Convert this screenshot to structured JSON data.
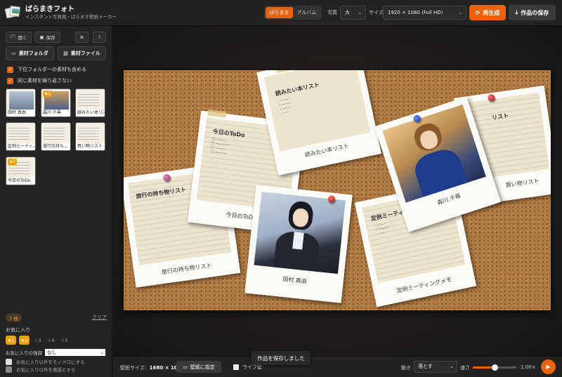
{
  "header": {
    "title": "ばらまきフォト",
    "subtitle": "インスタント写真風・ばらまき壁紙メーカー",
    "mode_tabs": [
      "ばらまき",
      "アルバム"
    ],
    "photo_label": "写真",
    "photo_size": "大",
    "size_label": "サイズ",
    "size_value": "1920 × 1080 (Full HD)",
    "regen_label": "再生成",
    "save_label": "作品の保存"
  },
  "sidebar": {
    "open_label": "開く",
    "save_label": "保存",
    "folder_btn": "素材フォルダ",
    "file_btn": "素材ファイル",
    "opt_subfolder": "下位フォルダーの素材も含める",
    "opt_norepeat": "同じ素材を繰り返さない",
    "thumbs": [
      {
        "caption": "田村 真由"
      },
      {
        "caption": "森川 千尋",
        "star": "★1"
      },
      {
        "caption": "読みたい本リスト"
      },
      {
        "caption": "定例ミーティ..."
      },
      {
        "caption": "旅行の持ち..."
      },
      {
        "caption": "買い物リスト"
      },
      {
        "caption": "今日のToDo",
        "star": "★2"
      }
    ],
    "count": "7 枚",
    "clear": "クリア",
    "fav_label": "お気に入り",
    "fav_buttons": [
      "★1",
      "★2",
      "☆3",
      "☆4",
      "☆5"
    ],
    "emph_label": "お気に入りの強調",
    "emph_value": "なし",
    "opt_mono": "お気に入り以外をモノクロにする",
    "opt_trans": "お気に入り以外を透過とする"
  },
  "cards": [
    {
      "title": "旅行の持ち物リスト",
      "caption": "旅行の持ち物リスト"
    },
    {
      "title": "今日のToDo",
      "caption": "今日のToDo"
    },
    {
      "title": "読みたい本リスト",
      "caption": "読みたい本リスト"
    },
    {
      "caption": "田村 真由"
    },
    {
      "title": "定例ミーティ",
      "caption": "定例ミーティングメモ"
    },
    {
      "caption": "森川 千尋"
    },
    {
      "title": "リスト",
      "caption": "買い物リスト"
    }
  ],
  "bottom": {
    "wp_size_label": "壁紙サイズ：",
    "wp_size_value": "1680 × 1050",
    "set_wall": "壁紙に設定",
    "live": "ライブ壁",
    "toast": "作品を保存しました",
    "motion_label": "動き",
    "motion_value": "落とす",
    "speed_label": "速さ",
    "speed_fraction": 0.5,
    "speed_value": "1.00×"
  },
  "colors": {
    "accent": "#e8630a",
    "star": "#e8a20a",
    "cork": "#b07a44"
  }
}
